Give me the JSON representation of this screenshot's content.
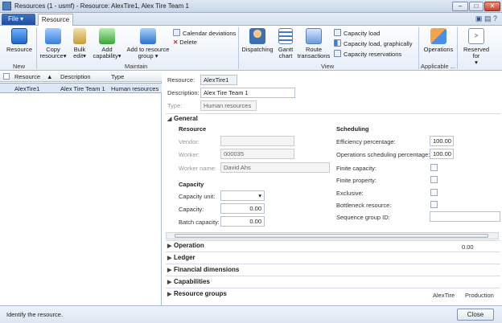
{
  "window": {
    "title": "Resources (1 - usmf) - Resource: AlexTire1, Alex Tire Team 1"
  },
  "tabs": {
    "file": "File",
    "resource": "Resource"
  },
  "ribbon": {
    "new_group": {
      "label": "New",
      "resource": "Resource"
    },
    "maintain_group": {
      "label": "Maintain",
      "copy_resource_line1": "Copy",
      "copy_resource_line2": "resource",
      "bulk_edit_line1": "Bulk",
      "bulk_edit_line2": "edit",
      "add_capability_line1": "Add",
      "add_capability_line2": "capability",
      "add_to_group_line1": "Add to resource",
      "add_to_group_line2": "group",
      "calendar_deviations": "Calendar deviations",
      "delete": "Delete"
    },
    "view_group": {
      "label": "View",
      "dispatching": "Dispatching",
      "gantt_line1": "Gantt",
      "gantt_line2": "chart",
      "route_line1": "Route",
      "route_line2": "transactions",
      "capacity_load": "Capacity load",
      "capacity_load_graphically": "Capacity load, graphically",
      "capacity_reservations": "Capacity reservations"
    },
    "applicable_group": {
      "label": "Applicable ...",
      "operations": "Operations"
    },
    "reserved_group": {
      "line1": "Reserved",
      "line2": "for"
    }
  },
  "grid": {
    "headers": {
      "resource": "Resource",
      "description": "Description",
      "type": "Type"
    },
    "rows": [
      {
        "resource": "AlexTire1",
        "description": "Alex Tire Team 1",
        "type": "Human resources"
      }
    ]
  },
  "detail": {
    "resource_label": "Resource:",
    "resource_value": "AlexTire1",
    "description_label": "Description:",
    "description_value": "Alex Tire Team 1",
    "type_label": "Type:",
    "type_value": "Human resources"
  },
  "general": {
    "title": "General",
    "resource_section": "Resource",
    "vendor_label": "Vendor:",
    "vendor_value": "",
    "worker_label": "Worker:",
    "worker_value": "000035",
    "worker_name_label": "Worker name:",
    "worker_name_value": "David Ahs",
    "capacity_section": "Capacity",
    "capacity_unit_label": "Capacity unit:",
    "capacity_unit_value": "",
    "capacity_label": "Capacity:",
    "capacity_value": "0.00",
    "batch_capacity_label": "Batch capacity:",
    "batch_capacity_value": "0.00",
    "scheduling_section": "Scheduling",
    "efficiency_label": "Efficiency percentage:",
    "efficiency_value": "100.00",
    "ops_sched_label": "Operations scheduling percentage:",
    "ops_sched_value": "100.00",
    "finite_capacity_label": "Finite capacity:",
    "finite_property_label": "Finite property:",
    "exclusive_label": "Exclusive:",
    "bottleneck_label": "Bottleneck resource:",
    "sequence_group_label": "Sequence group ID:",
    "sequence_group_value": ""
  },
  "sections": {
    "operation": {
      "title": "Operation",
      "summary": "0.00"
    },
    "ledger": {
      "title": "Ledger"
    },
    "financial_dimensions": {
      "title": "Financial dimensions"
    },
    "capabilities": {
      "title": "Capabilities"
    },
    "resource_groups": {
      "title": "Resource groups",
      "summary1": "AlexTire",
      "summary2": "Production"
    }
  },
  "status": {
    "text": "Identify the resource.",
    "close": "Close"
  }
}
